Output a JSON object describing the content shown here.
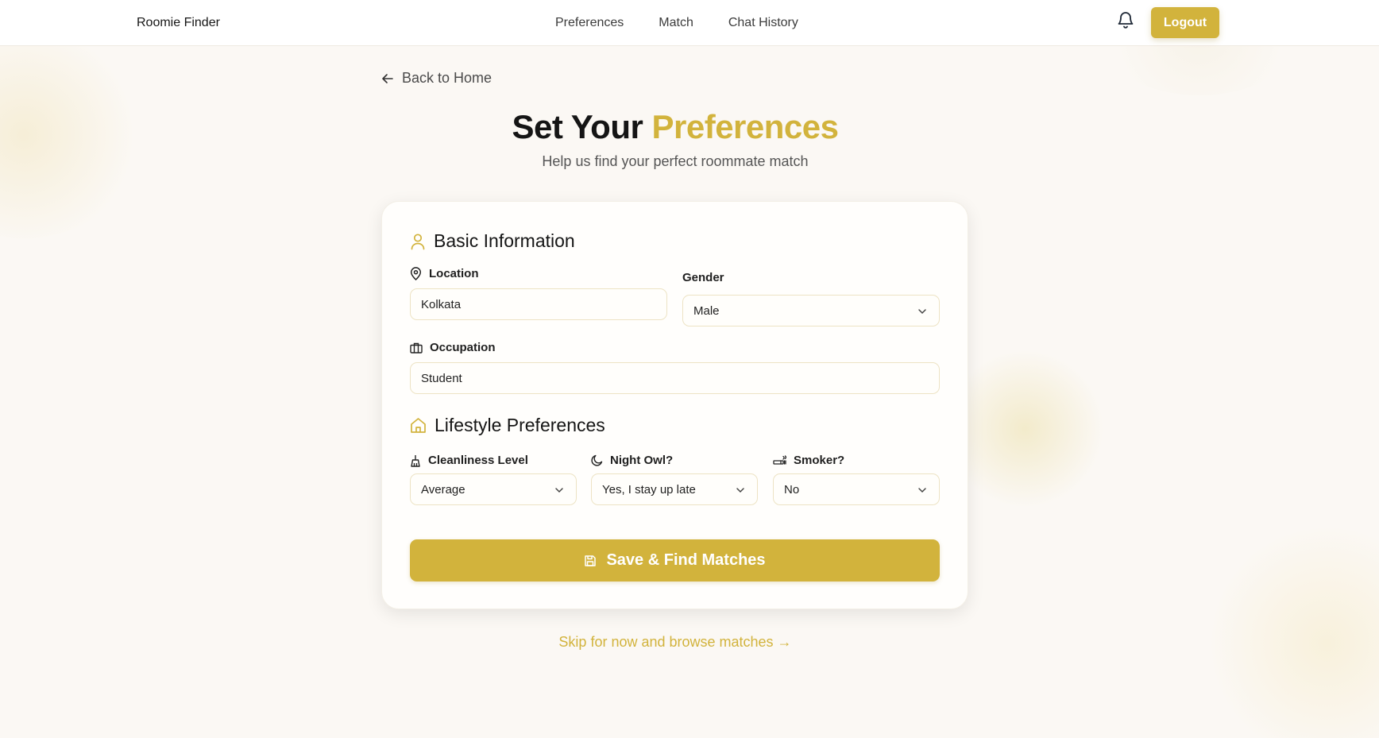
{
  "nav": {
    "brand": "Roomie Finder",
    "links": [
      "Preferences",
      "Match",
      "Chat History"
    ],
    "logout_label": "Logout"
  },
  "back_label": "Back to Home",
  "header": {
    "title_prefix": "Set Your",
    "title_accent": "Preferences",
    "subtitle": "Help us find your perfect roommate match"
  },
  "basic": {
    "heading": "Basic Information",
    "location_label": "Location",
    "location_value": "Kolkata",
    "gender_label": "Gender",
    "gender_value": "Male",
    "occupation_label": "Occupation",
    "occupation_value": "Student"
  },
  "lifestyle": {
    "heading": "Lifestyle Preferences",
    "cleanliness_label": "Cleanliness Level",
    "cleanliness_value": "Average",
    "nightowl_label": "Night Owl?",
    "nightowl_value": "Yes, I stay up late",
    "smoker_label": "Smoker?",
    "smoker_value": "No"
  },
  "save_label": "Save & Find Matches",
  "skip_label": "Skip for now and browse matches →",
  "colors": {
    "accent": "#d2b33c",
    "background": "#fbf8f4"
  }
}
